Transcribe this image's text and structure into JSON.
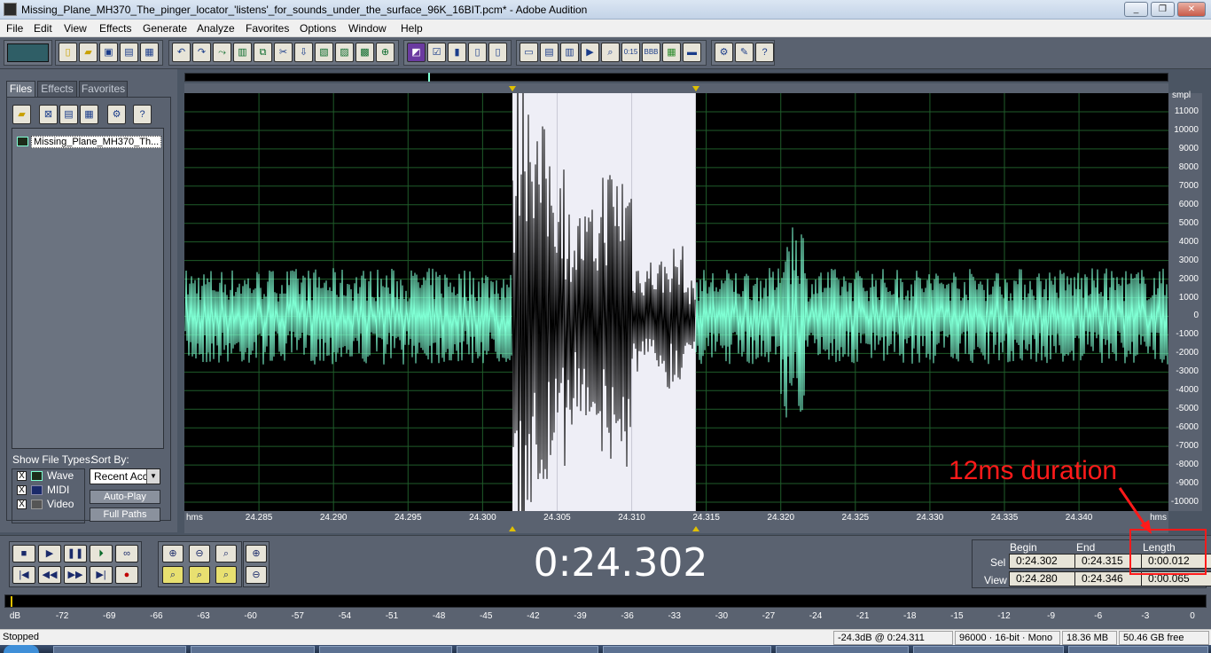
{
  "window": {
    "title": "Missing_Plane_MH370_The_pinger_locator_'listens'_for_sounds_under_the_surface_96K_16BIT.pcm* - Adobe Audition",
    "minimize": "_",
    "restore": "❐",
    "close": "✕"
  },
  "menu": [
    "File",
    "Edit",
    "View",
    "Effects",
    "Generate",
    "Analyze",
    "Favorites",
    "Options",
    "Window",
    "Help"
  ],
  "left_panel": {
    "tabs": [
      "Files",
      "Effects",
      "Favorites"
    ],
    "file_name": "Missing_Plane_MH370_Th...",
    "show_file_types_label": "Show File Types:",
    "sort_by_label": "Sort By:",
    "file_types": [
      {
        "label": "Wave",
        "checked": "X"
      },
      {
        "label": "MIDI",
        "checked": "X"
      },
      {
        "label": "Video",
        "checked": "X"
      }
    ],
    "sort_value": "Recent Acc",
    "auto_play": "Auto-Play",
    "full_paths": "Full Paths"
  },
  "waveform": {
    "amplitude_unit": "smpl",
    "amplitude_labels": [
      "11000",
      "10000",
      "9000",
      "8000",
      "7000",
      "6000",
      "5000",
      "4000",
      "3000",
      "2000",
      "1000",
      "0",
      "-1000",
      "-2000",
      "-3000",
      "-4000",
      "-5000",
      "-6000",
      "-7000",
      "-8000",
      "-9000",
      "-10000"
    ],
    "amplitude_values": [
      11000,
      10000,
      9000,
      8000,
      7000,
      6000,
      5000,
      4000,
      3000,
      2000,
      1000,
      0,
      -1000,
      -2000,
      -3000,
      -4000,
      -5000,
      -6000,
      -7000,
      -8000,
      -9000,
      -10000
    ],
    "time_unit_left": "hms",
    "time_unit_right": "hms",
    "time_labels": [
      "24.285",
      "24.290",
      "24.295",
      "24.300",
      "24.305",
      "24.310",
      "24.315",
      "24.320",
      "24.325",
      "24.330",
      "24.335",
      "24.340"
    ],
    "time_values": [
      24.285,
      24.29,
      24.295,
      24.3,
      24.305,
      24.31,
      24.315,
      24.32,
      24.325,
      24.33,
      24.335,
      24.34
    ],
    "view_start": 24.28,
    "view_end": 24.346,
    "selection_start": 24.302,
    "selection_end": 24.3143,
    "colors": {
      "wave": "#7fffd4",
      "selected_wave": "#000000",
      "selection_bg": "#eeeef6",
      "background": "#000000",
      "grid": "#1f5c2a"
    }
  },
  "transport": {
    "time_display": "0:24.302",
    "begin_label": "Begin",
    "end_label": "End",
    "length_label": "Length",
    "sel_label": "Sel",
    "view_label": "View",
    "sel_begin": "0:24.302",
    "sel_end": "0:24.315",
    "sel_length": "0:00.012",
    "view_begin": "0:24.280",
    "view_end": "0:24.346",
    "view_length": "0:00.065"
  },
  "level_meter": {
    "labels": [
      "dB",
      "-72",
      "-69",
      "-66",
      "-63",
      "-60",
      "-57",
      "-54",
      "-51",
      "-48",
      "-45",
      "-42",
      "-39",
      "-36",
      "-33",
      "-30",
      "-27",
      "-24",
      "-21",
      "-18",
      "-15",
      "-12",
      "-9",
      "-6",
      "-3",
      "0"
    ]
  },
  "status": {
    "state": "Stopped",
    "level_at": "-24.3dB @  0:24.311",
    "format": "96000 · 16-bit · Mono",
    "file_size": "18.36 MB",
    "free_space": "50.46 GB free"
  },
  "annotation": {
    "text": "12ms duration",
    "color": "#ff1a1a"
  }
}
